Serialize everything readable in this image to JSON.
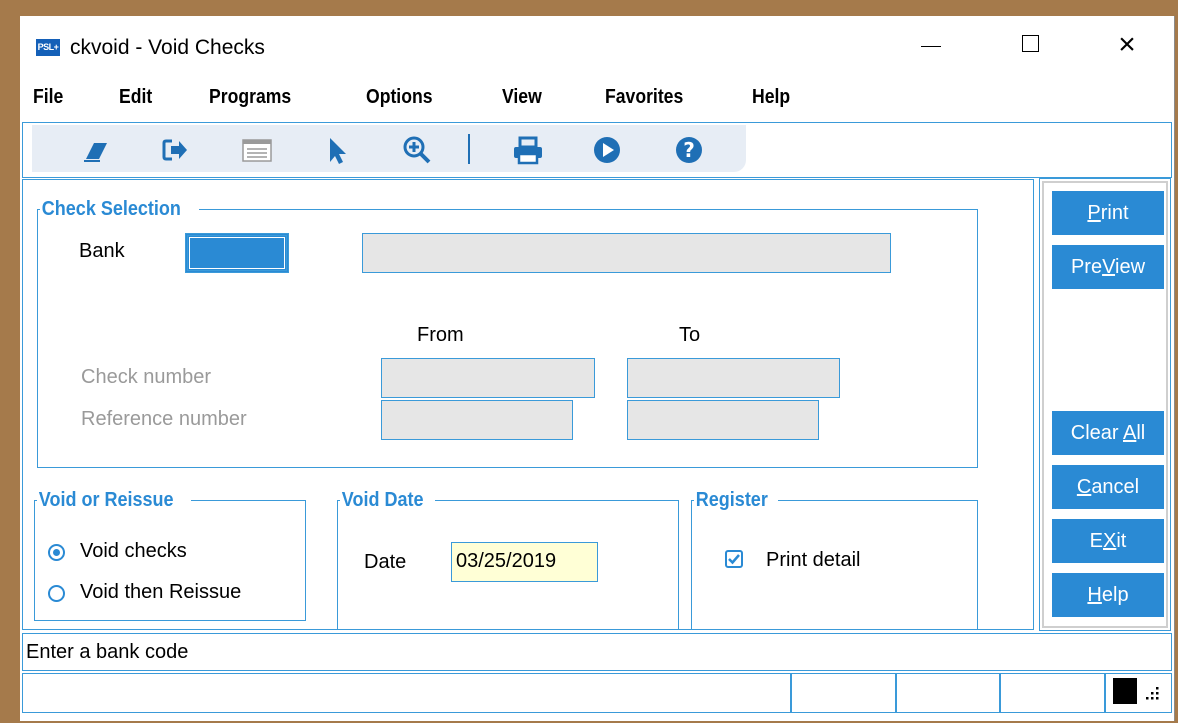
{
  "window": {
    "app_icon_text": "PSL+",
    "title": "ckvoid - Void Checks",
    "controls": {
      "minimize": "minimize",
      "maximize": "maximize",
      "close": "×"
    }
  },
  "menu": [
    "File",
    "Edit",
    "Programs",
    "Options",
    "View",
    "Favorites",
    "Help"
  ],
  "toolbar": {
    "icons": [
      "eraser-icon",
      "exit-arrow-icon",
      "list-window-icon",
      "pointer-icon",
      "zoom-in-icon",
      "printer-icon",
      "play-icon",
      "help-icon"
    ]
  },
  "check_selection": {
    "legend": "Check Selection",
    "bank_label": "Bank",
    "bank_value": "",
    "bank_name": "",
    "from_label": "From",
    "to_label": "To",
    "check_number_label": "Check number",
    "reference_number_label": "Reference number"
  },
  "void_or_reissue": {
    "legend": "Void or Reissue",
    "options": [
      "Void checks",
      "Void then Reissue"
    ],
    "selected": "Void checks"
  },
  "void_date": {
    "legend": "Void Date",
    "date_label": "Date",
    "date_value": "03/25/2019"
  },
  "register": {
    "legend": "Register",
    "print_detail_label": "Print detail",
    "print_detail_checked": true
  },
  "buttons": {
    "print": {
      "pre": "",
      "key": "P",
      "post": "rint"
    },
    "preview": {
      "pre": "Pre",
      "key": "V",
      "post": "iew"
    },
    "clear_all": {
      "pre": "Clear ",
      "key": "A",
      "post": "ll"
    },
    "cancel": {
      "pre": "",
      "key": "C",
      "post": "ancel"
    },
    "exit": {
      "pre": "E",
      "key": "X",
      "post": "it"
    },
    "help": {
      "pre": "",
      "key": "H",
      "post": "elp"
    }
  },
  "status": {
    "message": "Enter a bank code"
  },
  "colors": {
    "accent": "#2a8ad4",
    "border": "#3a9ad9",
    "frame": "#a57a4b",
    "date_bg": "#ffffd6"
  }
}
